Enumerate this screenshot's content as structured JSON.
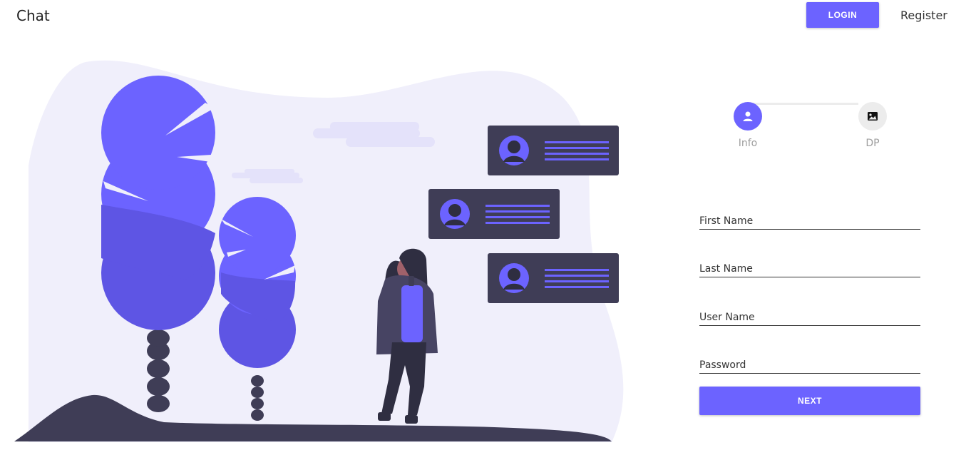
{
  "header": {
    "brand": "Chat",
    "login_label": "LOGIN",
    "register_label": "Register"
  },
  "stepper": {
    "steps": [
      {
        "label": "Info",
        "icon": "person-icon",
        "active": true
      },
      {
        "label": "DP",
        "icon": "image-icon",
        "active": false
      }
    ]
  },
  "form": {
    "first_name": {
      "placeholder": "First Name",
      "value": ""
    },
    "last_name": {
      "placeholder": "Last Name",
      "value": ""
    },
    "user_name": {
      "placeholder": "User Name",
      "value": ""
    },
    "password": {
      "placeholder": "Password",
      "value": ""
    },
    "next_label": "NEXT"
  },
  "colors": {
    "accent": "#6c63ff",
    "dark": "#3f3d56",
    "blob": "#f0effb"
  }
}
